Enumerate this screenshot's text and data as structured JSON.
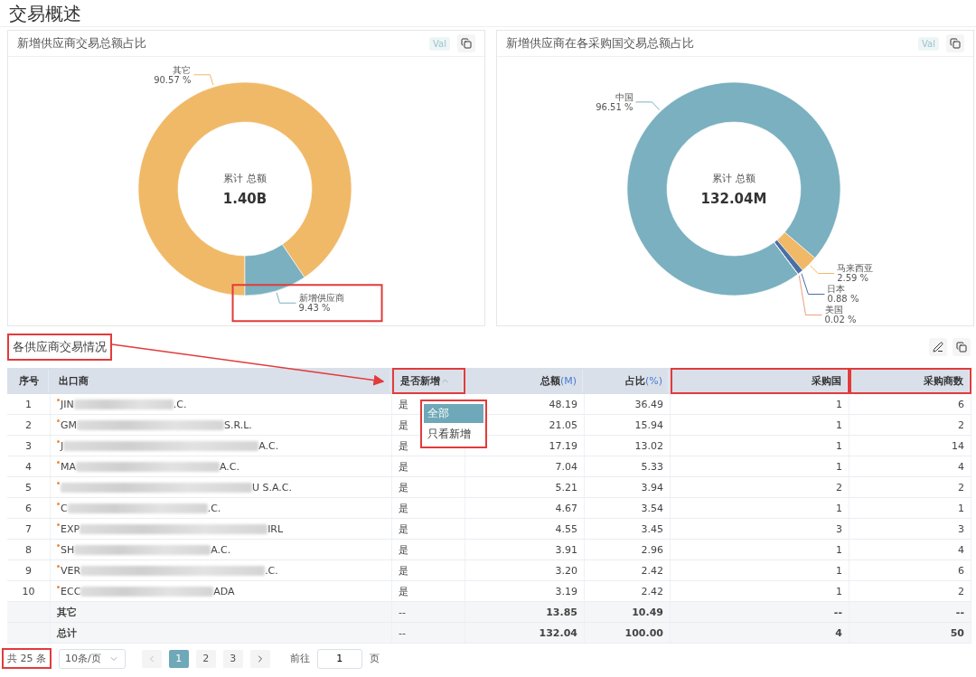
{
  "page_title": "交易概述",
  "charts": [
    {
      "title": "新增供应商交易总额占比",
      "val_button": "Val",
      "center_label": "累计 总额",
      "center_value": "1.40B",
      "highlighted_labels": [
        false,
        true
      ],
      "chart_data": {
        "type": "donut",
        "categories": [
          "其它",
          "新增供应商"
        ],
        "values": [
          90.57,
          9.43
        ],
        "value_labels": [
          "90.57 %",
          "9.43 %"
        ],
        "colors": [
          "#f0b968",
          "#7ab0bf"
        ]
      }
    },
    {
      "title": "新增供应商在各采购国交易总额占比",
      "val_button": "Val",
      "center_label": "累计 总额",
      "center_value": "132.04M",
      "highlighted_labels": [
        false,
        false,
        false,
        false
      ],
      "chart_data": {
        "type": "donut",
        "categories": [
          "中国",
          "马来西亚",
          "日本",
          "美国"
        ],
        "values": [
          96.51,
          2.59,
          0.88,
          0.02
        ],
        "value_labels": [
          "96.51 %",
          "2.59 %",
          "0.88 %",
          "0.02 %"
        ],
        "colors": [
          "#7ab0bf",
          "#f0b968",
          "#4a6fa5",
          "#ec9f7d"
        ]
      }
    }
  ],
  "table_section": {
    "title": "各供应商交易情况",
    "title_highlighted": true,
    "arrow": true
  },
  "table": {
    "columns": [
      {
        "label": "序号",
        "highlighted": false
      },
      {
        "label": "出口商",
        "highlighted": false
      },
      {
        "label": "是否新增",
        "highlighted": true,
        "menu_open": true
      },
      {
        "label": "总额",
        "unit": "(M)",
        "highlighted": false
      },
      {
        "label": "占比",
        "unit": "(%)",
        "highlighted": false
      },
      {
        "label": "采购国",
        "highlighted": true
      },
      {
        "label": "采购商数",
        "highlighted": true
      }
    ],
    "filter_menu": {
      "highlighted": true,
      "options": [
        {
          "label": "全部",
          "selected": true
        },
        {
          "label": "只看新增",
          "selected": false
        }
      ]
    },
    "rows": [
      {
        "kind": "data",
        "index": "1",
        "flagged": true,
        "exporter_start": "JIN",
        "exporter_end": ".C.",
        "is_new": "是",
        "total": "48.19",
        "share": "36.49",
        "countries": "1",
        "buyers": "6"
      },
      {
        "kind": "data",
        "index": "2",
        "flagged": true,
        "exporter_start": "GM",
        "exporter_end": "S.R.L.",
        "is_new": "是",
        "total": "21.05",
        "share": "15.94",
        "countries": "1",
        "buyers": "2"
      },
      {
        "kind": "data",
        "index": "3",
        "flagged": true,
        "exporter_start": "J",
        "exporter_end": "A.C.",
        "is_new": "是",
        "total": "17.19",
        "share": "13.02",
        "countries": "1",
        "buyers": "14"
      },
      {
        "kind": "data",
        "index": "4",
        "flagged": true,
        "exporter_start": "MA",
        "exporter_end": "A.C.",
        "is_new": "是",
        "total": "7.04",
        "share": "5.33",
        "countries": "1",
        "buyers": "4"
      },
      {
        "kind": "data",
        "index": "5",
        "flagged": true,
        "exporter_end": "U S.A.C.",
        "is_new": "是",
        "total": "5.21",
        "share": "3.94",
        "countries": "2",
        "buyers": "2"
      },
      {
        "kind": "data",
        "index": "6",
        "flagged": true,
        "exporter_start": "C",
        "exporter_end": ".C.",
        "is_new": "是",
        "total": "4.67",
        "share": "3.54",
        "countries": "1",
        "buyers": "1"
      },
      {
        "kind": "data",
        "index": "7",
        "flagged": true,
        "exporter_start": "EXP",
        "exporter_end": "IRL",
        "is_new": "是",
        "total": "4.55",
        "share": "3.45",
        "countries": "3",
        "buyers": "3"
      },
      {
        "kind": "data",
        "index": "8",
        "flagged": true,
        "exporter_start": "SH",
        "exporter_end": "A.C.",
        "is_new": "是",
        "total": "3.91",
        "share": "2.96",
        "countries": "1",
        "buyers": "4"
      },
      {
        "kind": "data",
        "index": "9",
        "flagged": true,
        "exporter_start": "VER",
        "exporter_end": ".C.",
        "is_new": "是",
        "total": "3.20",
        "share": "2.42",
        "countries": "1",
        "buyers": "6"
      },
      {
        "kind": "data",
        "index": "10",
        "flagged": true,
        "exporter_start": "ECC",
        "exporter_end": "ADA",
        "is_new": "是",
        "total": "3.19",
        "share": "2.42",
        "countries": "1",
        "buyers": "2"
      },
      {
        "kind": "summary",
        "label": "其它",
        "is_new": "--",
        "total": "13.85",
        "share": "10.49",
        "countries": "--",
        "buyers": "--"
      },
      {
        "kind": "summary",
        "label": "总计",
        "is_new": "--",
        "total": "132.04",
        "share": "100.00",
        "countries": "4",
        "buyers": "50"
      }
    ]
  },
  "pagination": {
    "total": "共 25 条",
    "total_highlighted": true,
    "page_size": "10条/页",
    "pages": [
      {
        "label": "1",
        "selected": true
      },
      {
        "label": "2",
        "selected": false
      },
      {
        "label": "3",
        "selected": false
      }
    ],
    "goto_label": "前往",
    "goto_value": "1",
    "goto_suffix": "页"
  }
}
